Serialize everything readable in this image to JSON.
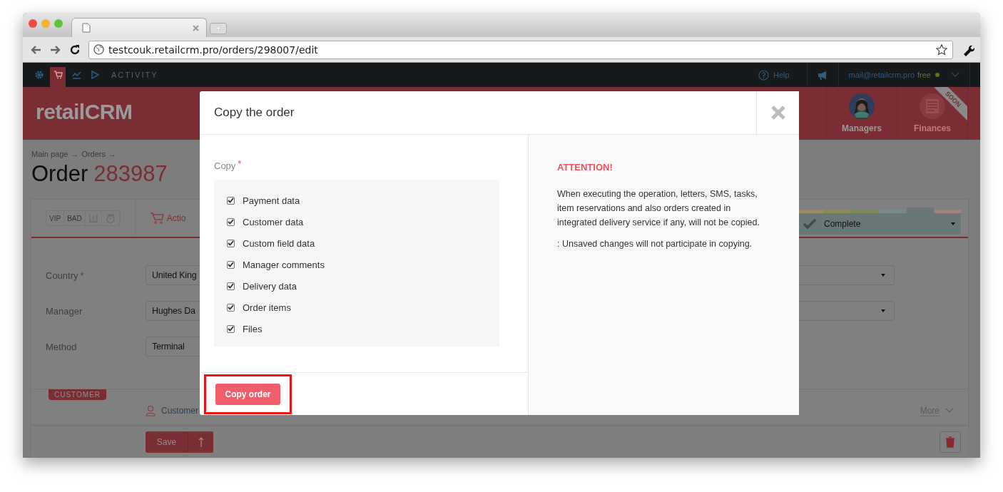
{
  "browser": {
    "url": "testcouk.retailcrm.pro/orders/298007/edit",
    "new_tab": "+"
  },
  "app_bar": {
    "nav": [
      {
        "kind": "settings",
        "selected": false
      },
      {
        "kind": "cart",
        "selected": true
      },
      {
        "kind": "chart",
        "selected": false
      },
      {
        "kind": "play",
        "selected": false
      }
    ],
    "section": "ACTIVITY",
    "help": "Help",
    "user_email": "mail@retailcrm.pro",
    "plan": "free"
  },
  "header": {
    "logo": "retailCRM",
    "tiles": [
      {
        "label": "Managers",
        "kind": "avatar",
        "disabled": false
      },
      {
        "label": "Finances",
        "kind": "ledger",
        "disabled": true,
        "badge": "SOON"
      }
    ]
  },
  "page": {
    "required_mark": "*",
    "breadcrumb": [
      "Main page",
      "Orders"
    ],
    "separator": "→",
    "title": "Order",
    "number": "283987",
    "tags": [
      {
        "kind": "text",
        "label": "VIP"
      },
      {
        "kind": "text",
        "label": "BAD"
      },
      {
        "kind": "flag"
      },
      {
        "kind": "alarm"
      }
    ],
    "action": "Actio",
    "status": {
      "label": "Complete",
      "segments": [
        {
          "color": "#9a8a6a",
          "selected": false
        },
        {
          "color": "#8a8a5c",
          "selected": false
        },
        {
          "color": "#7a8a5c",
          "selected": false
        },
        {
          "color": "#7a8a88",
          "selected": false
        },
        {
          "color": "#6b7676",
          "selected": true
        },
        {
          "color": "#a08282",
          "selected": false
        }
      ]
    },
    "fields": [
      {
        "label": "Country",
        "required": true,
        "value": "United King",
        "right_dropdown": true
      },
      {
        "label": "Manager",
        "required": false,
        "value": "Hughes Da",
        "right_dropdown": true
      },
      {
        "label": "Method",
        "required": false,
        "value": "Terminal",
        "right_dropdown": false
      }
    ],
    "customer": {
      "section": "CUSTOMER",
      "link": "Customer",
      "more": "More"
    },
    "save": "Save"
  },
  "modal": {
    "title": "Copy the order",
    "copy_label": "Copy",
    "required": true,
    "required_mark": "*",
    "options": [
      {
        "label": "Payment data",
        "checked": true
      },
      {
        "label": "Customer data",
        "checked": true
      },
      {
        "label": "Custom field data",
        "checked": true
      },
      {
        "label": "Manager comments",
        "checked": true
      },
      {
        "label": "Delivery data",
        "checked": true
      },
      {
        "label": "Order items",
        "checked": true
      },
      {
        "label": "Files",
        "checked": true
      }
    ],
    "button": {
      "label": "Copy order",
      "highlighted": true
    },
    "attention": "ATTENTION!",
    "paragraphs": [
      "When executing the operation, letters, SMS, tasks, item reservations and also orders created in integrated delivery service if any, will not be copied.",
      ": Unsaved changes will not participate in copying."
    ]
  }
}
